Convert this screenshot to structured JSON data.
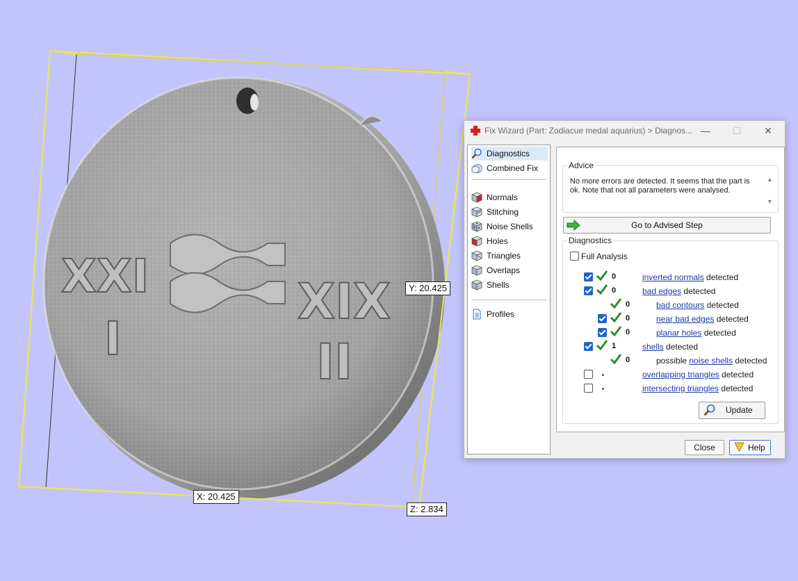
{
  "viewport": {
    "background": "#c4c4fc",
    "dimensions": {
      "x": "X: 20.425",
      "y": "Y: 20.425",
      "z": "Z: 2.834"
    },
    "medal": {
      "left_numerals": [
        "XXI",
        "I"
      ],
      "right_numerals": [
        "XIX",
        "II"
      ]
    }
  },
  "dialog": {
    "title": "Fix Wizard (Part: Zodiacue medal aquarius) > Diagnos...",
    "window_buttons": {
      "minimize": "—",
      "maximize": "☐",
      "close": "✕"
    },
    "nav": {
      "items": [
        {
          "label": "Diagnostics",
          "icon": "magnifier-icon",
          "selected": true
        },
        {
          "label": "Combined Fix",
          "icon": "combined-fix-icon"
        },
        {
          "label": "Normals",
          "icon": "normals-cube-icon"
        },
        {
          "label": "Stitching",
          "icon": "stitching-cube-icon"
        },
        {
          "label": "Noise Shells",
          "icon": "noise-shells-cube-icon"
        },
        {
          "label": "Holes",
          "icon": "holes-cube-icon"
        },
        {
          "label": "Triangles",
          "icon": "triangles-cube-icon"
        },
        {
          "label": "Overlaps",
          "icon": "overlaps-cube-icon"
        },
        {
          "label": "Shells",
          "icon": "shells-cube-icon"
        },
        {
          "label": "Profiles",
          "icon": "document-icon"
        }
      ]
    },
    "advice": {
      "title": "Advice",
      "text": "No more errors are detected. It seems that the part is ok. Note that not all parameters were analysed."
    },
    "advised_step_button": "Go to Advised Step",
    "diagnostics": {
      "title": "Diagnostics",
      "full_analysis_label": "Full Analysis",
      "full_analysis_checked": false,
      "rows": [
        {
          "checked": true,
          "status": "ok",
          "count": "0",
          "prefix": "",
          "link": "inverted normals",
          "suffix": " detected"
        },
        {
          "checked": true,
          "status": "ok",
          "count": "0",
          "prefix": "",
          "link": "bad edges",
          "suffix": " detected"
        },
        {
          "checked": null,
          "status": "ok",
          "count": "0",
          "prefix": "",
          "link": "bad contours",
          "suffix": " detected"
        },
        {
          "checked": true,
          "status": "ok",
          "count": "0",
          "prefix": "",
          "link": "near bad edges",
          "suffix": " detected"
        },
        {
          "checked": true,
          "status": "ok",
          "count": "0",
          "prefix": "",
          "link": "planar holes",
          "suffix": " detected"
        },
        {
          "checked": true,
          "status": "ok",
          "count": "1",
          "prefix": "",
          "link": "shells",
          "suffix": " detected"
        },
        {
          "checked": null,
          "status": "ok",
          "count": "0",
          "prefix": "possible ",
          "link": "noise shells",
          "suffix": " detected"
        },
        {
          "checked": false,
          "status": "unknown",
          "count": "",
          "prefix": "",
          "link": "overlapping triangles",
          "suffix": " detected"
        },
        {
          "checked": false,
          "status": "unknown",
          "count": "",
          "prefix": "",
          "link": "intersecting triangles",
          "suffix": " detected"
        }
      ]
    },
    "update_button": "Update",
    "close_button": "Close",
    "help_button": "Help",
    "colors": {
      "accent": "#1e66c8",
      "ok_tick": "#2e8b2e",
      "link": "#1a3aa8"
    }
  }
}
